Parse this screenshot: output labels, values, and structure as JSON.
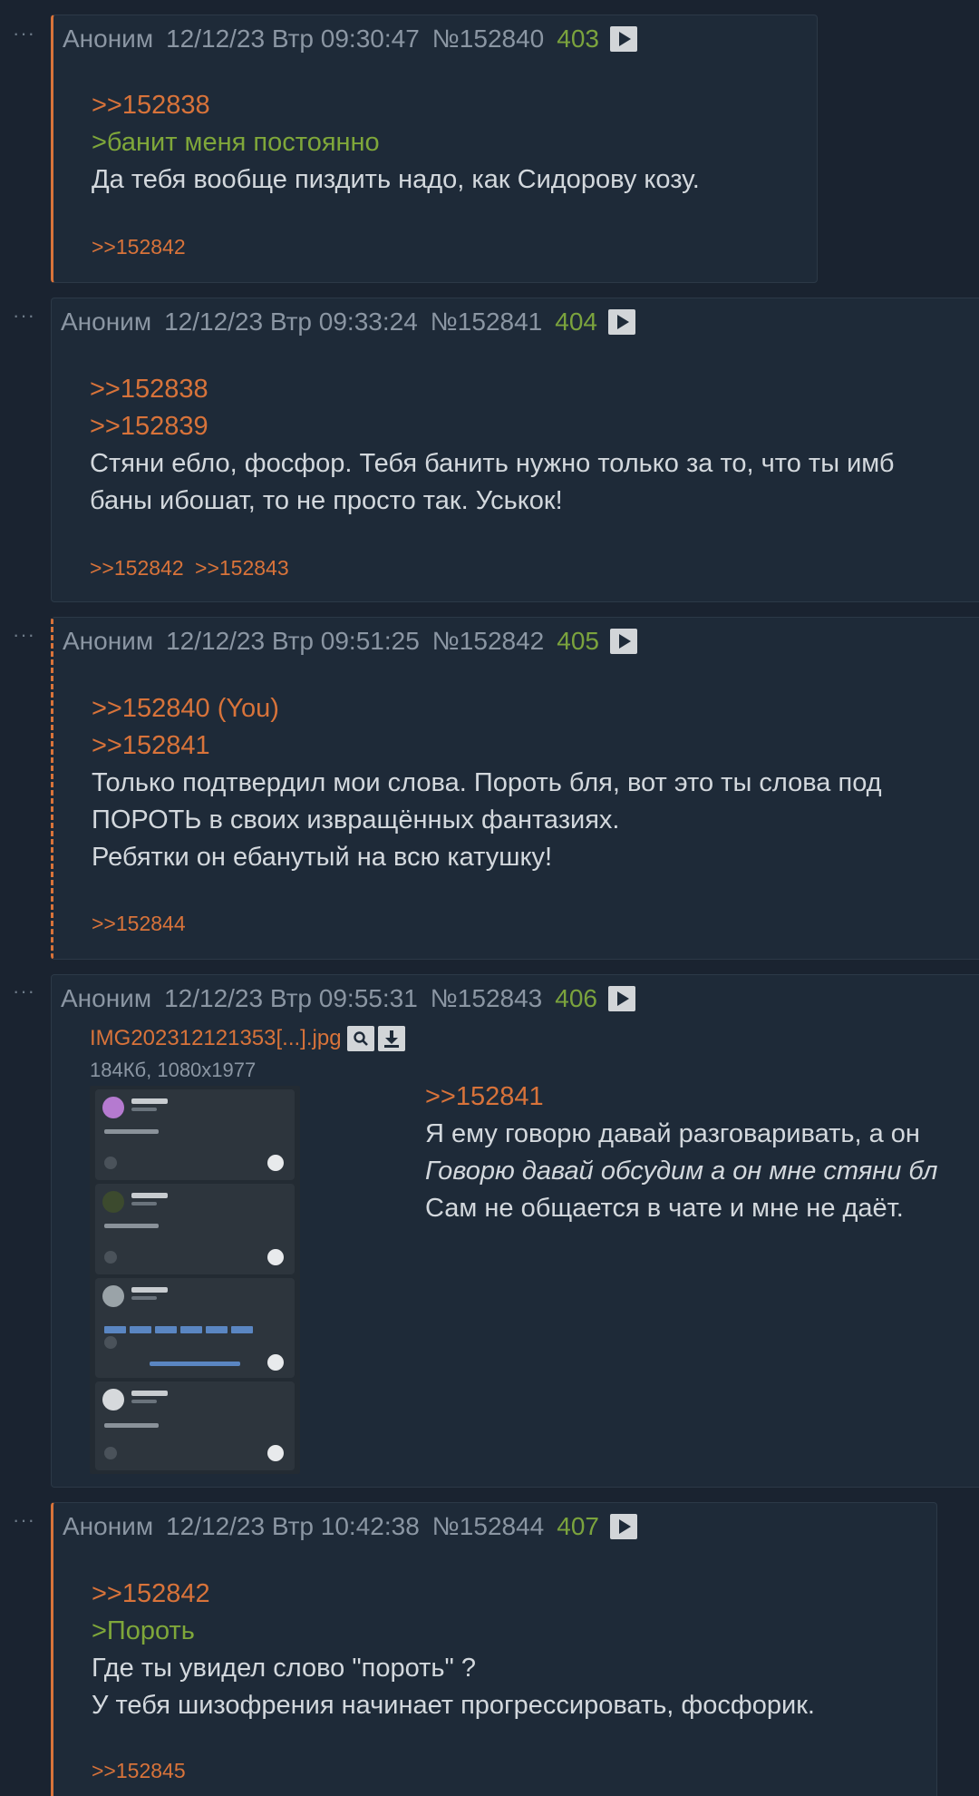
{
  "menu_glyph": "···",
  "posts": [
    {
      "name": "Аноним",
      "date": "12/12/23 Втр 09:30:47",
      "num": "№152840",
      "count": "403",
      "body": [
        {
          "text": ">>152838",
          "kind": "ref"
        },
        {
          "text": ">банит меня постоянно",
          "kind": "quote"
        },
        {
          "text": "Да тебя вообще пиздить надо, как Сидорову козу.",
          "kind": "text"
        }
      ],
      "replies": [
        ">>152842"
      ]
    },
    {
      "name": "Аноним",
      "date": "12/12/23 Втр 09:33:24",
      "num": "№152841",
      "count": "404",
      "body": [
        {
          "text": ">>152838",
          "kind": "ref"
        },
        {
          "text": ">>152839",
          "kind": "ref"
        },
        {
          "text": "Стяни ебло, фосфор. Тебя банить нужно только за то, что ты имб",
          "kind": "text"
        },
        {
          "text": "баны ибошат, то не просто так. Уськок!",
          "kind": "text"
        }
      ],
      "replies": [
        ">>152842",
        ">>152843"
      ]
    },
    {
      "name": "Аноним",
      "date": "12/12/23 Втр 09:51:25",
      "num": "№152842",
      "count": "405",
      "body": [
        {
          "text": ">>152840 (You)",
          "kind": "ref"
        },
        {
          "text": ">>152841",
          "kind": "ref"
        },
        {
          "text": "Только подтвердил мои слова. Пороть бля, вот это ты слова под",
          "kind": "text"
        },
        {
          "text": "ПОРОТЬ в своих извращённых фантазиях.",
          "kind": "text"
        },
        {
          "text": "Ребятки он ебанутый на всю катушку!",
          "kind": "text"
        }
      ],
      "replies": [
        ">>152844"
      ]
    },
    {
      "name": "Аноним",
      "date": "12/12/23 Втр 09:55:31",
      "num": "№152843",
      "count": "406",
      "file": {
        "name": "IMG202312121353[...].jpg",
        "meta": "184Кб, 1080x1977",
        "zoom_icon": "search-icon",
        "download_icon": "download-icon"
      },
      "body": [
        {
          "text": ">>152841",
          "kind": "ref"
        },
        {
          "text": "Я ему говорю давай разговаривать, а он",
          "kind": "text"
        },
        {
          "text": "Говорю давай обсудим а он мне стяни бл",
          "kind": "italic"
        },
        {
          "text": "Сам не общается в чате и мне не даёт.",
          "kind": "text"
        }
      ],
      "replies": []
    },
    {
      "name": "Аноним",
      "date": "12/12/23 Втр 10:42:38",
      "num": "№152844",
      "count": "407",
      "body": [
        {
          "text": ">>152842",
          "kind": "ref"
        },
        {
          "text": ">Пороть",
          "kind": "quote"
        },
        {
          "text": "Где ты увидел слово \"пороть\" ?",
          "kind": "text"
        },
        {
          "text": "У тебя шизофрения начинает прогрессировать, фосфорик.",
          "kind": "text"
        }
      ],
      "replies": [
        ">>152845"
      ]
    }
  ],
  "colors": {
    "background": "#1a2330",
    "post_bg": "#1e2a38",
    "link": "#d8733a",
    "greentext": "#7fa73a",
    "counter": "#7ba33d",
    "meta": "#8b96a3",
    "text": "#d3d8dd"
  }
}
